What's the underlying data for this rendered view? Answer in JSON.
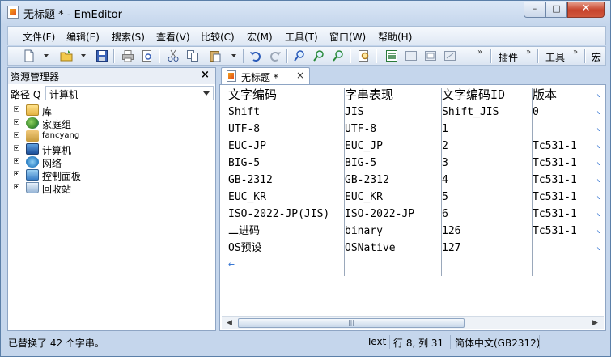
{
  "window": {
    "title": "无标题 * - EmEditor",
    "controls": {
      "minimize": "–",
      "maximize": "□",
      "close": "✕"
    }
  },
  "menu": [
    "文件(F)",
    "编辑(E)",
    "搜索(S)",
    "查看(V)",
    "比较(C)",
    "宏(M)",
    "工具(T)",
    "窗口(W)",
    "帮助(H)"
  ],
  "toolbar": {
    "icons": [
      "new-file-icon",
      "open-folder-icon",
      "save-icon",
      "print-icon",
      "print-preview-icon",
      "cut-icon",
      "copy-icon",
      "paste-icon",
      "undo-icon",
      "redo-icon",
      "find-icon",
      "find-next-icon",
      "find-previous-icon",
      "find-in-files-icon",
      "view-mode-icon",
      "window-icon-1",
      "window-icon-2",
      "window-icon-3"
    ],
    "plugins_label": "插件",
    "tools_label": "工具",
    "macro_label": "宏"
  },
  "explorer": {
    "title": "资源管理器",
    "close": "×",
    "path_label": "路径 Q",
    "path_value": "计算机",
    "tree": [
      {
        "label": "库",
        "icon": "library-icon"
      },
      {
        "label": "家庭组",
        "icon": "homegroup-icon"
      },
      {
        "label": "fancyang",
        "icon": "user-folder-icon"
      },
      {
        "label": "计算机",
        "icon": "computer-icon"
      },
      {
        "label": "网络",
        "icon": "network-icon"
      },
      {
        "label": "控制面板",
        "icon": "control-panel-icon"
      },
      {
        "label": "回收站",
        "icon": "recycle-bin-icon"
      }
    ]
  },
  "tab": {
    "label": "无标题 *",
    "close": "×"
  },
  "document": {
    "header": [
      "文字编码",
      "字串表现",
      "文字编码ID",
      "版本"
    ],
    "rows": [
      [
        "Shift",
        "JIS",
        "Shift_JIS",
        "0"
      ],
      [
        "UTF-8",
        "UTF-8",
        "1",
        ""
      ],
      [
        "EUC-JP",
        "EUC_JP",
        "2",
        "Tc531-1"
      ],
      [
        "BIG-5",
        "BIG-5",
        "3",
        "Tc531-1"
      ],
      [
        "GB-2312",
        "GB-2312",
        "4",
        "Tc531-1"
      ],
      [
        "EUC_KR",
        "EUC_KR",
        "5",
        "Tc531-1"
      ],
      [
        "ISO-2022-JP(JIS)",
        "ISO-2022-JP",
        "6",
        "Tc531-1"
      ],
      [
        "二进码",
        "binary",
        "126",
        "Tc531-1"
      ],
      [
        "OS预设",
        "OSNative",
        "127",
        ""
      ]
    ],
    "eof_marker": "←"
  },
  "scrollbar": {
    "left": "◀",
    "right": "▶",
    "thumb": "|||"
  },
  "status": {
    "message": "已替换了 42 个字串。",
    "mode": "Text",
    "position": "行 8, 列 31",
    "encoding": "简体中文(GB2312)"
  }
}
